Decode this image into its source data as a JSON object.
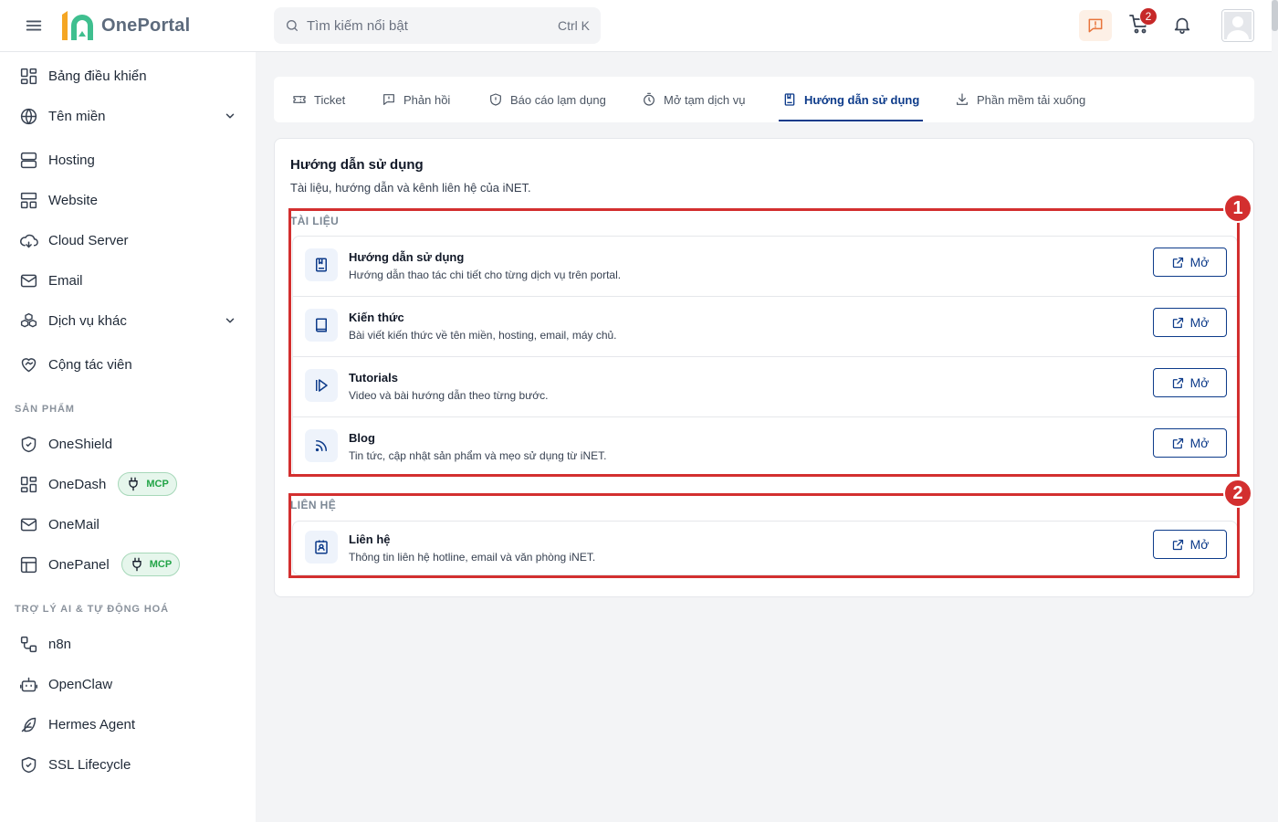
{
  "header": {
    "logo_text": "OnePortal",
    "search_placeholder": "Tìm kiếm nổi bật",
    "search_shortcut": "Ctrl K",
    "cart_count": "2"
  },
  "sidebar": {
    "items": [
      {
        "label": "Bảng điều khiển"
      },
      {
        "label": "Tên miền"
      },
      {
        "label": "Hosting"
      },
      {
        "label": "Website"
      },
      {
        "label": "Cloud Server"
      },
      {
        "label": "Email"
      },
      {
        "label": "Dịch vụ khác"
      },
      {
        "label": "Cộng tác viên"
      }
    ],
    "section_products": "SẢN PHẨM",
    "products": [
      {
        "label": "OneShield"
      },
      {
        "label": "OneDash",
        "badge": "MCP"
      },
      {
        "label": "OneMail"
      },
      {
        "label": "OnePanel",
        "badge": "MCP"
      }
    ],
    "section_ai": "TRỢ LÝ AI & TỰ ĐỘNG HOÁ",
    "ai_items": [
      {
        "label": "n8n"
      },
      {
        "label": "OpenClaw"
      },
      {
        "label": "Hermes Agent"
      },
      {
        "label": "SSL Lifecycle"
      }
    ]
  },
  "tabs": [
    {
      "label": "Ticket",
      "icon": "ticket-icon"
    },
    {
      "label": "Phản hồi",
      "icon": "feedback-icon"
    },
    {
      "label": "Báo cáo lạm dụng",
      "icon": "shield-alert-icon"
    },
    {
      "label": "Mở tạm dịch vụ",
      "icon": "timer-icon"
    },
    {
      "label": "Hướng dẫn sử dụng",
      "icon": "bookmark-book-icon",
      "active": true
    },
    {
      "label": "Phần mềm tải xuống",
      "icon": "download-icon"
    }
  ],
  "card": {
    "title": "Hướng dẫn sử dụng",
    "subtitle": "Tài liệu, hướng dẫn và kênh liên hệ của iNET.",
    "docs_label": "TÀI LIỆU",
    "docs": [
      {
        "title": "Hướng dẫn sử dụng",
        "desc": "Hướng dẫn thao tác chi tiết cho từng dịch vụ trên portal.",
        "button": "Mở",
        "icon": "bookmark-book-icon"
      },
      {
        "title": "Kiến thức",
        "desc": "Bài viết kiến thức về tên miền, hosting, email, máy chủ.",
        "button": "Mở",
        "icon": "book-icon"
      },
      {
        "title": "Tutorials",
        "desc": "Video và bài hướng dẫn theo từng bước.",
        "button": "Mở",
        "icon": "play-icon"
      },
      {
        "title": "Blog",
        "desc": "Tin tức, cập nhật sản phẩm và mẹo sử dụng từ iNET.",
        "button": "Mở",
        "icon": "rss-icon"
      }
    ],
    "contact_label": "LIÊN HỆ",
    "contacts": [
      {
        "title": "Liên hệ",
        "desc": "Thông tin liên hệ hotline, email và văn phòng iNET.",
        "button": "Mở",
        "icon": "contact-card-icon"
      }
    ]
  },
  "annotations": [
    "1",
    "2"
  ],
  "colors": {
    "accent": "#0d3b8a",
    "annotation": "#d32f2f",
    "badge_red": "#c62828",
    "mcp_green": "#22a447"
  }
}
